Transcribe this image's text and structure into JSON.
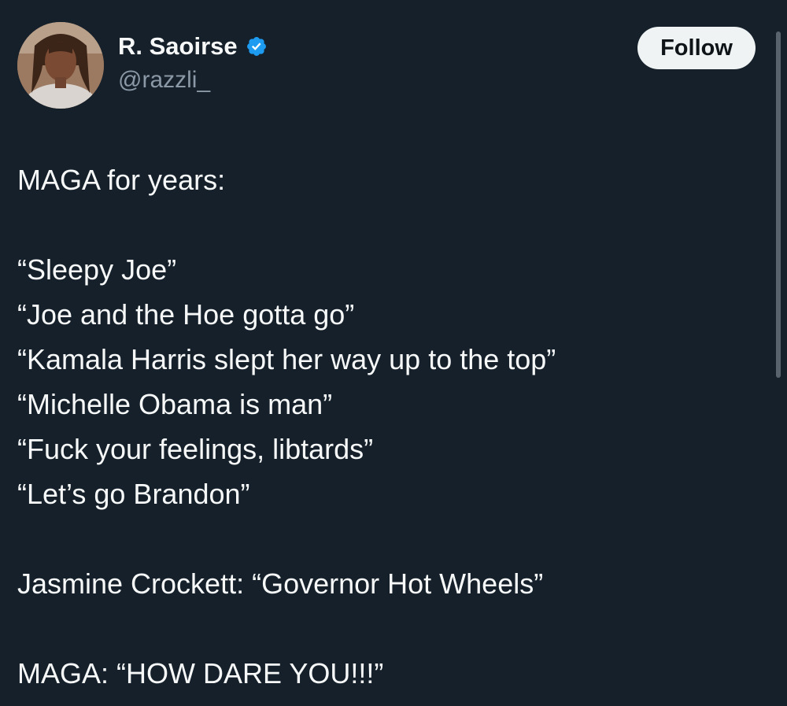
{
  "author": {
    "display_name": "R. Saoirse",
    "handle": "@razzli_",
    "verified": true,
    "verified_color": "#1d9bf0"
  },
  "follow_button": {
    "label": "Follow"
  },
  "tweet": {
    "lines": [
      "MAGA for years:",
      "",
      "“Sleepy Joe”",
      "“Joe and the Hoe gotta go”",
      "“Kamala Harris slept her way up to the top”",
      "“Michelle Obama is man”",
      "“Fuck your feelings, libtards”",
      "“Let’s go Brandon”",
      "",
      "Jasmine Crockett: “Governor Hot Wheels”",
      "",
      "MAGA: “HOW DARE YOU!!!”"
    ]
  },
  "theme": {
    "background": "#15202b",
    "text": "#f7f9f9",
    "secondary_text": "#8b98a5",
    "button_bg": "#eff3f4"
  }
}
